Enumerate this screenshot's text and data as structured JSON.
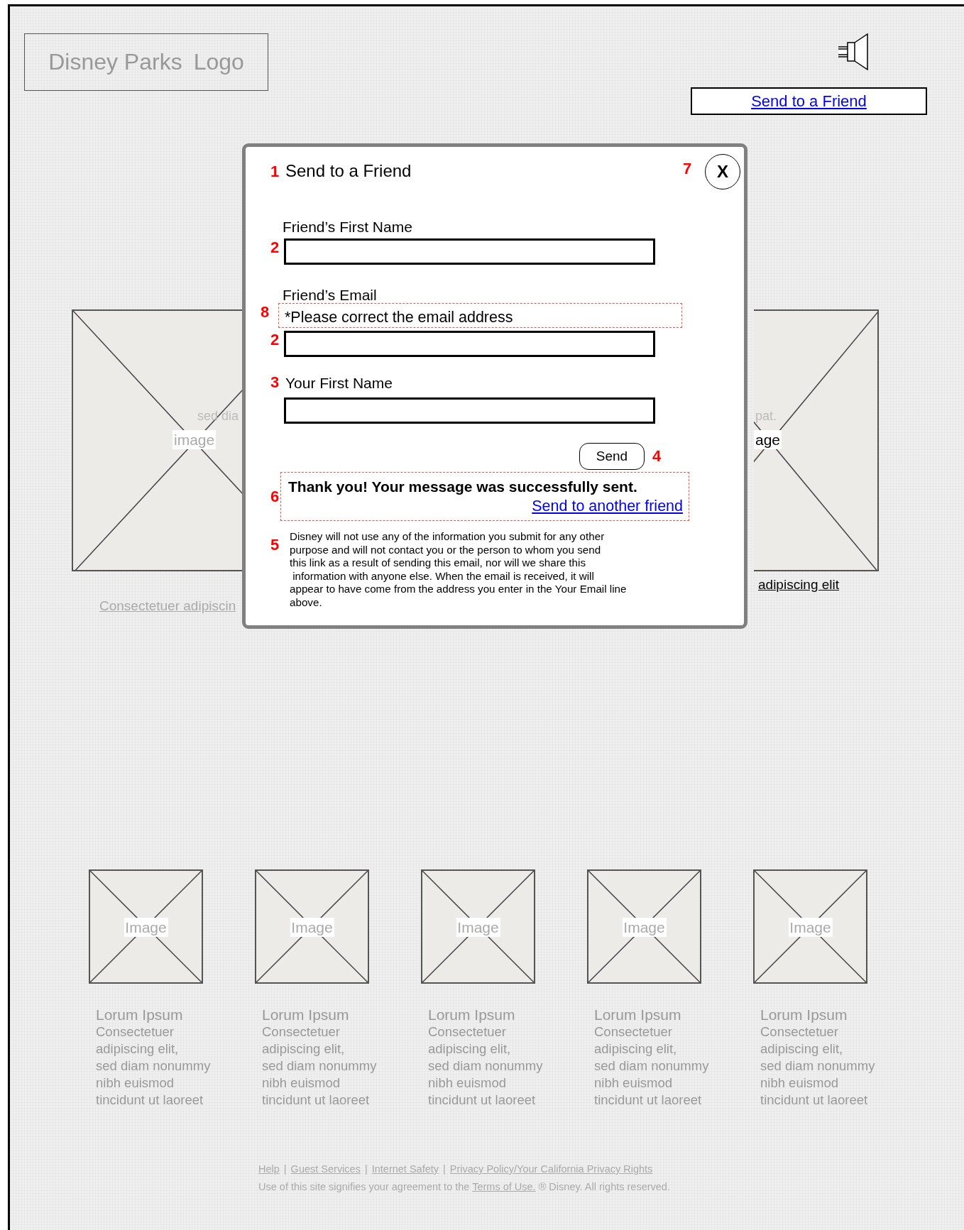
{
  "header": {
    "logo": {
      "brand": "Disney Parks",
      "label": "Logo"
    },
    "share_button": "Send to a Friend"
  },
  "background": {
    "left_image": {
      "label": "image",
      "caption_fragment": "sed dia",
      "link": "Consectetuer adipiscin"
    },
    "right_image": {
      "label": "age",
      "caption_fragment": "pat.",
      "link": "adipiscing elit"
    }
  },
  "dialog": {
    "title": "Send to a Friend",
    "title_marker": "1",
    "close": "X",
    "close_marker": "7",
    "fields": [
      {
        "label": "Friend’s First Name",
        "marker": "2"
      },
      {
        "label": "Friend’s Email",
        "error": "*Please correct the email address",
        "error_marker": "8",
        "marker": "2"
      },
      {
        "label": "Your First Name",
        "marker": "3"
      }
    ],
    "send": "Send",
    "send_marker": "4",
    "success": {
      "message": "Thank you! Your message was successfully sent.",
      "link": "Send to another friend",
      "marker": "6"
    },
    "disclaimer": {
      "text": "Disney will not use any of the information you submit for any other\npurpose and will not contact you or the person to whom you send\nthis link as a result of sending this email, nor will we share this\n information with anyone else. When the email is received, it will\nappear to have come from the address you enter in the Your Email line\nabove.",
      "marker": "5"
    }
  },
  "thumbnails": [
    {
      "label": "Image",
      "title": "Lorum Ipsum",
      "text": "Consectetuer\nadipiscing elit,\nsed diam nonummy\nnibh euismod\ntincidunt ut laoreet"
    },
    {
      "label": "Image",
      "title": "Lorum Ipsum",
      "text": "Consectetuer\nadipiscing elit,\nsed diam nonummy\nnibh euismod\ntincidunt ut laoreet"
    },
    {
      "label": "Image",
      "title": "Lorum Ipsum",
      "text": "Consectetuer\nadipiscing elit,\nsed diam nonummy\nnibh euismod\ntincidunt ut laoreet"
    },
    {
      "label": "Image",
      "title": "Lorum Ipsum",
      "text": "Consectetuer\nadipiscing elit,\nsed diam nonummy\nnibh euismod\ntincidunt ut laoreet"
    },
    {
      "label": "Image",
      "title": "Lorum Ipsum",
      "text": "Consectetuer\nadipiscing elit,\nsed diam nonummy\nnibh euismod\ntincidunt ut laoreet"
    }
  ],
  "footer": {
    "links": [
      {
        "text": "Help"
      },
      {
        "separator": "|",
        "text": "Guest Services"
      },
      {
        "separator": "|",
        "text": "Internet Safety"
      },
      {
        "separator": "|",
        "text": "Privacy Policy/Your California Privacy Rights"
      }
    ],
    "notice_before": "Use of this site signifies your agreement to the",
    "terms_link": "Terms of Use.",
    "notice_after": "® Disney. All rights reserved."
  }
}
